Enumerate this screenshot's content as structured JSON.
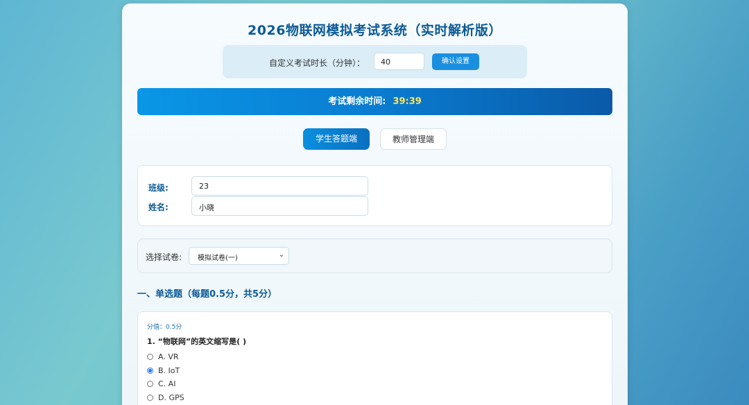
{
  "title": "2026物联网模拟考试系统（实时解析版）",
  "settings": {
    "label": "自定义考试时长（分钟）：",
    "duration_value": "40",
    "confirm_label": "确认设置"
  },
  "timer": {
    "label": "考试剩余时间:",
    "value": "39:39"
  },
  "tabs": [
    {
      "label": "学生答题端",
      "active": true
    },
    {
      "label": "教师管理端",
      "active": false
    }
  ],
  "student": {
    "class_label": "班级:",
    "class_value": "23",
    "name_label": "姓名:",
    "name_value": "小晓"
  },
  "paper_select": {
    "label": "选择试卷:",
    "selected": "模拟试卷(一)"
  },
  "section": {
    "title": "一、单选题（每题0.5分，共5分）"
  },
  "question": {
    "score": "分值：0.5分",
    "text": "1. “物联网”的英文缩写是( )",
    "options": [
      {
        "label": "A. VR",
        "checked": false
      },
      {
        "label": "B. IoT",
        "checked": true
      },
      {
        "label": "C. AI",
        "checked": false
      },
      {
        "label": "D. GPS",
        "checked": false
      }
    ]
  },
  "colors": {
    "accent": "#1a8fe0",
    "heading": "#0c5a96",
    "timer_value": "#ffe45c"
  }
}
